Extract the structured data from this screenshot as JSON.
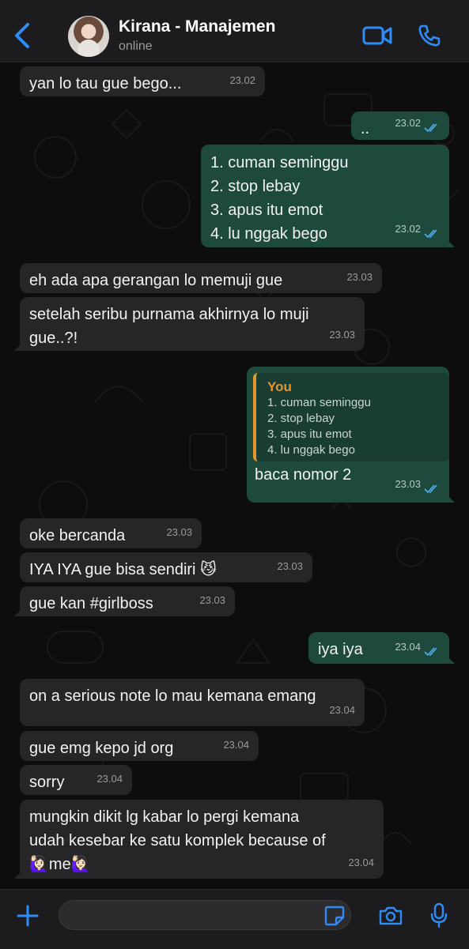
{
  "header": {
    "back_icon": "chevron-left-icon",
    "contact_name": "Kirana - Manajemen",
    "status": "online",
    "video_icon": "video-camera-icon",
    "call_icon": "phone-icon",
    "accent_color": "#2f8cf6"
  },
  "messages": [
    {
      "direction": "in",
      "text": "yan lo tau gue bego...",
      "time": "23.02"
    },
    {
      "direction": "out",
      "text": "..",
      "time": "23.02",
      "read": true
    },
    {
      "direction": "out",
      "lines": [
        "1. cuman seminggu",
        "2. stop lebay",
        "3. apus itu emot",
        "4. lu nggak bego"
      ],
      "time": "23.02",
      "read": true
    },
    {
      "direction": "in",
      "text": "eh ada apa gerangan lo memuji gue",
      "time": "23.03"
    },
    {
      "direction": "in",
      "lines": [
        "setelah seribu purnama akhirnya lo muji",
        "gue..?!"
      ],
      "time": "23.03"
    },
    {
      "direction": "out",
      "reply": {
        "author": "You",
        "lines": [
          "1. cuman seminggu",
          "2. stop lebay",
          "3. apus itu emot",
          "4. lu nggak bego"
        ]
      },
      "text": "baca nomor 2",
      "time": "23.03",
      "read": true
    },
    {
      "direction": "in",
      "text": "oke bercanda",
      "time": "23.03"
    },
    {
      "direction": "in",
      "text": "IYA IYA gue bisa sendiri 😼",
      "time": "23.03"
    },
    {
      "direction": "in",
      "text": "gue kan #girlboss",
      "time": "23.03"
    },
    {
      "direction": "out",
      "text": "iya iya",
      "time": "23.04",
      "read": true
    },
    {
      "direction": "in",
      "text": "on a serious note lo mau kemana emang",
      "time": "23.04"
    },
    {
      "direction": "in",
      "text": "gue emg kepo jd org",
      "time": "23.04"
    },
    {
      "direction": "in",
      "text": "sorry",
      "time": "23.04"
    },
    {
      "direction": "in",
      "lines": [
        "mungkin dikit lg kabar lo pergi kemana",
        "udah kesebar ke satu komplek because of",
        "🙋🏻‍♀️me🙋🏻‍♀️"
      ],
      "time": "23.04"
    }
  ],
  "input_bar": {
    "plus_icon": "plus-icon",
    "placeholder": "",
    "sticker_icon": "sticker-icon",
    "camera_icon": "camera-icon",
    "mic_icon": "microphone-icon"
  },
  "colors": {
    "incoming_bubble": "#262628",
    "outgoing_bubble": "#1e4a3e",
    "read_ticks": "#4fb3f6",
    "reply_bar": "#e7952a"
  }
}
